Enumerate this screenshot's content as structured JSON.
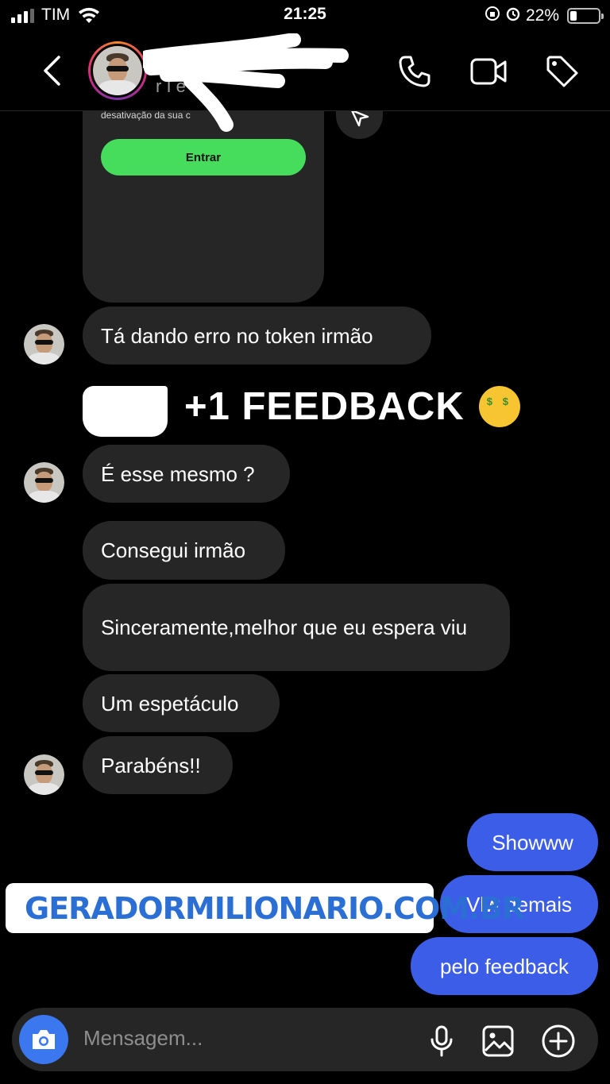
{
  "status_bar": {
    "carrier": "TIM",
    "time": "21:25",
    "battery": "22%"
  },
  "header": {
    "username_partial": "r   I   e   I"
  },
  "card": {
    "text": "desativação da sua c",
    "button": "Entrar"
  },
  "messages": {
    "m1": "Tá dando erro no token irmão",
    "m2": "É esse mesmo ?",
    "m3": "Consegui irmão",
    "m4": "Sinceramente,melhor que eu espera viu",
    "m5": "Um espetáculo",
    "m6": "Parabéns!!",
    "o1": "Showww",
    "o2": "Vlw demais",
    "o3": "pelo feedback"
  },
  "overlay": {
    "text": "+1 FEEDBACK",
    "link": "GERADORMILIONARIO.COM.BR"
  },
  "composer": {
    "placeholder": "Mensagem..."
  },
  "colors": {
    "outgoing": "#3b5de8",
    "incoming": "#262626",
    "button_green": "#46dc5c",
    "link_blue": "#2b6fd4"
  },
  "icons": [
    "back-icon",
    "phone-icon",
    "video-icon",
    "tag-icon",
    "send-icon",
    "link-icon",
    "camera-icon",
    "mic-icon",
    "gallery-icon",
    "plus-icon",
    "money-face-emoji"
  ]
}
